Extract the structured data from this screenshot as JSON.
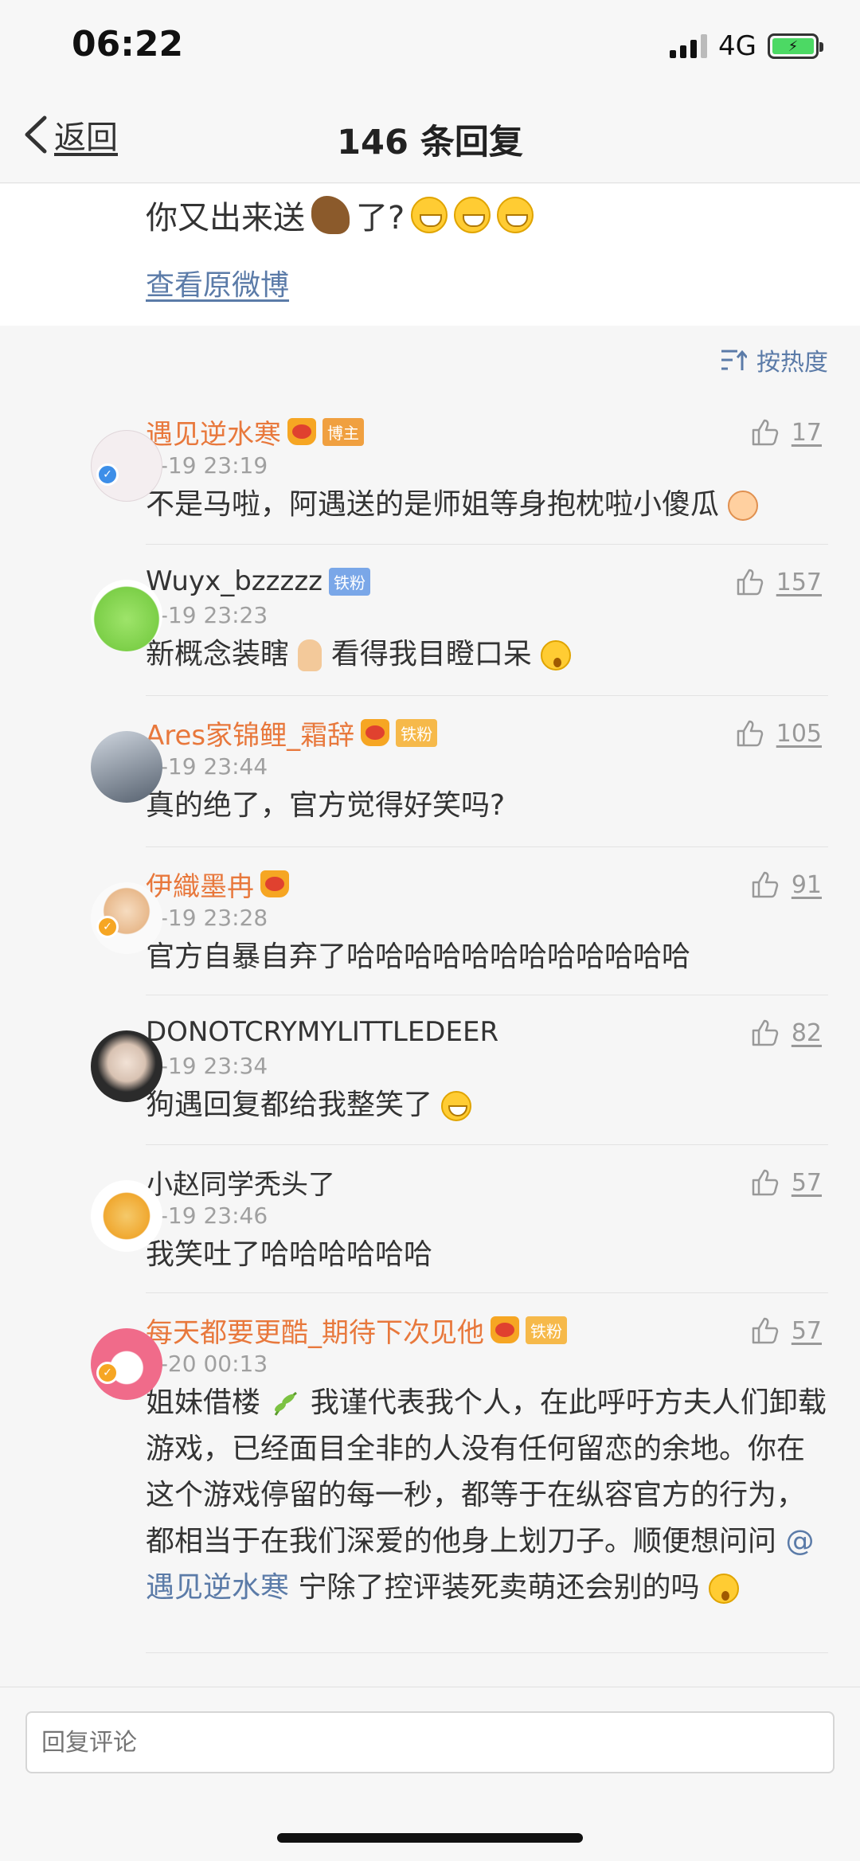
{
  "status": {
    "time": "06:22",
    "network": "4G"
  },
  "nav": {
    "back_label": "返回",
    "title": "146 条回复"
  },
  "post": {
    "text_before": "你又出来送",
    "text_after": "了?",
    "view_original": "查看原微博"
  },
  "sort": {
    "label": "按热度"
  },
  "comments": [
    {
      "name": "遇见逆水寒",
      "time": "1-19 23:19",
      "text": "不是马啦，阿遇送的是师姐等身抱枕啦小傻瓜",
      "likes": "17",
      "tag": "博主"
    },
    {
      "name": "Wuyx_bzzzzz",
      "time": "1-19 23:23",
      "text_a": "新概念装瞎",
      "text_b": "看得我目瞪口呆",
      "likes": "157",
      "tag": "铁粉"
    },
    {
      "name": "Ares家锦鲤_霜辞",
      "time": "1-19 23:44",
      "text": "真的绝了，官方觉得好笑吗?",
      "likes": "105",
      "tag": "铁粉"
    },
    {
      "name": "伊織墨冉",
      "time": "1-19 23:28",
      "text": "官方自暴自弃了哈哈哈哈哈哈哈哈哈哈哈哈",
      "likes": "91"
    },
    {
      "name": "DONOTCRYMYLITTLEDEER",
      "time": "1-19 23:34",
      "text": "狗遇回复都给我整笑了",
      "likes": "82"
    },
    {
      "name": "小赵同学秃头了",
      "time": "1-19 23:46",
      "text": "我笑吐了哈哈哈哈哈哈",
      "likes": "57"
    },
    {
      "name": "每天都要更酷_期待下次见他",
      "time": "1-20 00:13",
      "text_a": "姐妹借楼",
      "text_b": "我谨代表我个人，在此呼吁方夫人们卸载游戏，已经面目全非的人没有任何留恋的余地。你在这个游戏停留的每一秒，都等于在纵容官方的行为，都相当于在我们深爱的他身上划刀子。顺便想问问",
      "mention": "@遇见逆水寒",
      "text_c": "宁除了控评装死卖萌还会别的吗",
      "likes": "57",
      "tag": "铁粉"
    }
  ],
  "reply": {
    "placeholder": "回复评论"
  }
}
